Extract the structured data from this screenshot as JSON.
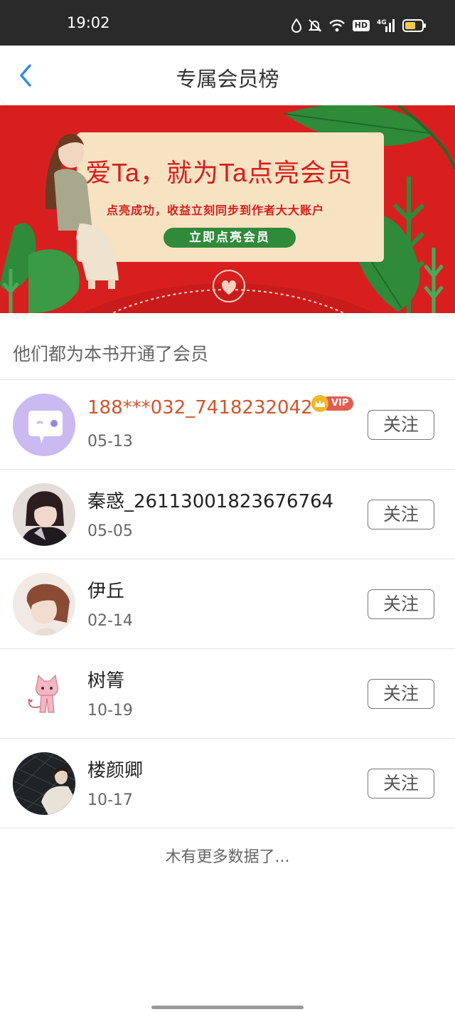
{
  "status_bar": {
    "time": "19:02",
    "hd_label": "HD",
    "network_label": "4G"
  },
  "header": {
    "title": "专属会员榜"
  },
  "banner": {
    "title": "爱Ta，就为Ta点亮会员",
    "subtitle": "点亮成功，收益立刻同步到作者大大账户",
    "button_label": "立即点亮会员"
  },
  "section": {
    "title": "他们都为本书开通了会员"
  },
  "members": [
    {
      "name": "188***032_7418232042",
      "date": "05-13",
      "vip": true,
      "vip_label": "VIP",
      "follow_label": "关注",
      "avatar": "chat-bubble-avatar"
    },
    {
      "name": "秦惑_26113001823676764",
      "date": "05-05",
      "vip": false,
      "follow_label": "关注",
      "avatar": "anime-portrait-avatar"
    },
    {
      "name": "伊丘",
      "date": "02-14",
      "vip": false,
      "follow_label": "关注",
      "avatar": "anime-portrait-avatar"
    },
    {
      "name": "树箐",
      "date": "10-19",
      "vip": false,
      "follow_label": "关注",
      "avatar": "pink-cat-avatar"
    },
    {
      "name": "楼颜卿",
      "date": "10-17",
      "vip": false,
      "follow_label": "关注",
      "avatar": "photo-avatar"
    }
  ],
  "footer": {
    "no_more_text": "木有更多数据了..."
  },
  "colors": {
    "banner_red": "#d81f1f",
    "vip_name": "#d4532b",
    "back_arrow": "#2d8ce8"
  }
}
